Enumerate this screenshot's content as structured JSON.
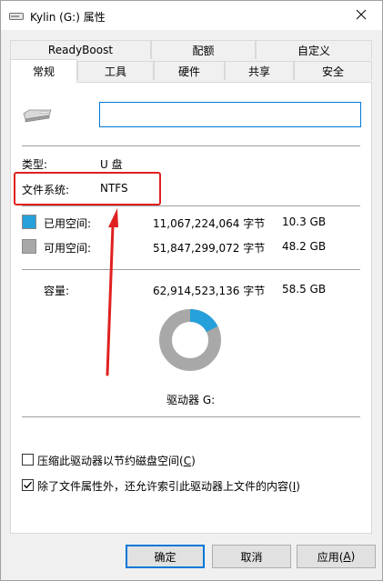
{
  "window": {
    "title": "Kylin (G:) 属性",
    "close_icon": "close-icon"
  },
  "tabs_top": [
    {
      "label": "ReadyBoost"
    },
    {
      "label": "配额"
    },
    {
      "label": "自定义"
    }
  ],
  "tabs_bottom": [
    {
      "label": "常规",
      "selected": true
    },
    {
      "label": "工具"
    },
    {
      "label": "硬件"
    },
    {
      "label": "共享"
    },
    {
      "label": "安全"
    }
  ],
  "general": {
    "drive_icon": "usb-drive-icon",
    "name_value": "",
    "type_label": "类型:",
    "type_value": "U 盘",
    "fs_label": "文件系统:",
    "fs_value": "NTFS",
    "used": {
      "label": "已用空间:",
      "bytes": "11,067,224,064 字节",
      "human": "10.3 GB",
      "color": "#26a0da"
    },
    "free": {
      "label": "可用空间:",
      "bytes": "51,847,299,072 字节",
      "human": "48.2 GB",
      "color": "#a8a8a8"
    },
    "capacity": {
      "label": "容量:",
      "bytes": "62,914,523,136 字节",
      "human": "58.5 GB"
    },
    "usage_fraction": 0.176,
    "drive_label": "驱动器 G:"
  },
  "checkboxes": [
    {
      "label_main": "压缩此驱动器以节约磁盘空间(",
      "accel": "C",
      "label_end": ")",
      "checked": false
    },
    {
      "label_main": "除了文件属性外，还允许索引此驱动器上文件的内容(",
      "accel": "I",
      "label_end": ")",
      "checked": true
    }
  ],
  "buttons": {
    "ok": "确定",
    "cancel": "取消",
    "apply_main": "应用(",
    "apply_accel": "A",
    "apply_end": ")"
  },
  "annotation": {
    "color": "#e02020"
  }
}
